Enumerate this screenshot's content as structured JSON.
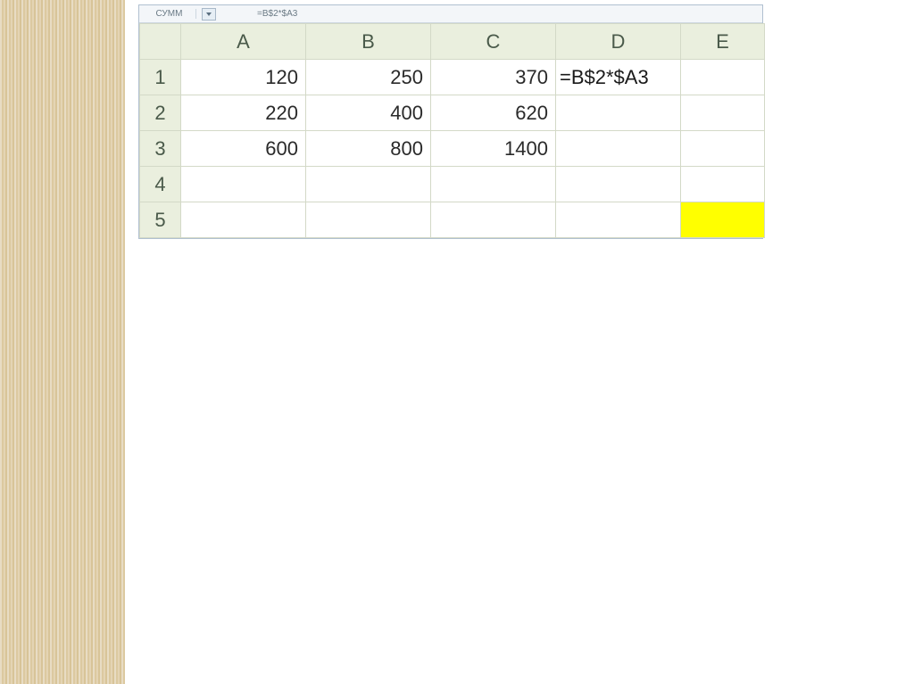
{
  "formula_bar": {
    "name_box": "СУММ",
    "formula": "=B$2*$A3"
  },
  "columns": [
    "A",
    "B",
    "C",
    "D",
    "E"
  ],
  "rows": [
    "1",
    "2",
    "3",
    "4",
    "5"
  ],
  "cells": {
    "r1": {
      "A": "120",
      "B": "250",
      "C": "370",
      "D": "=B$2*$A3",
      "E": ""
    },
    "r2": {
      "A": "220",
      "B": "400",
      "C": "620",
      "D": "",
      "E": ""
    },
    "r3": {
      "A": "600",
      "B": "800",
      "C": "1400",
      "D": "",
      "E": ""
    },
    "r4": {
      "A": "",
      "B": "",
      "C": "",
      "D": "",
      "E": ""
    },
    "r5": {
      "A": "",
      "B": "",
      "C": "",
      "D": "",
      "E": ""
    }
  }
}
